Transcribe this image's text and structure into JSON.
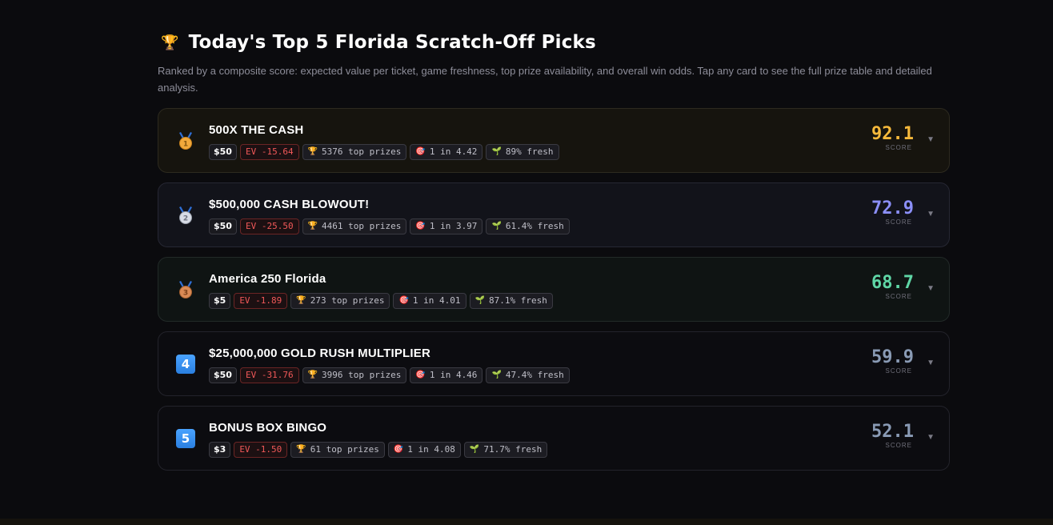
{
  "header": {
    "title": "Today's Top 5 Florida Scratch-Off Picks",
    "subtitle": "Ranked by a composite score: expected value per ticket, game freshness, top prize availability, and overall win odds. Tap any card to see the full prize table and detailed analysis."
  },
  "score_label": "SCORE",
  "games": [
    {
      "rank": "1",
      "rank_icon": "gold-medal-icon",
      "name": "500X THE CASH",
      "price": "$50",
      "ev": "EV -15.64",
      "top_prizes": "5376 top prizes",
      "odds": "1 in 4.42",
      "fresh": "89% fresh",
      "score": "92.1",
      "score_color": "#f6b93b"
    },
    {
      "rank": "2",
      "rank_icon": "silver-medal-icon",
      "name": "$500,000 CASH BLOWOUT!",
      "price": "$50",
      "ev": "EV -25.50",
      "top_prizes": "4461 top prizes",
      "odds": "1 in 3.97",
      "fresh": "61.4% fresh",
      "score": "72.9",
      "score_color": "#8b8ff8"
    },
    {
      "rank": "3",
      "rank_icon": "bronze-medal-icon",
      "name": "America 250 Florida",
      "price": "$5",
      "ev": "EV -1.89",
      "top_prizes": "273 top prizes",
      "odds": "1 in 4.01",
      "fresh": "87.1% fresh",
      "score": "68.7",
      "score_color": "#5fd6a6"
    },
    {
      "rank": "4",
      "rank_icon": "keycap-4-icon",
      "name": "$25,000,000 GOLD RUSH MULTIPLIER",
      "price": "$50",
      "ev": "EV -31.76",
      "top_prizes": "3996 top prizes",
      "odds": "1 in 4.46",
      "fresh": "47.4% fresh",
      "score": "59.9",
      "score_color": "#8a9bb5"
    },
    {
      "rank": "5",
      "rank_icon": "keycap-5-icon",
      "name": "BONUS BOX BINGO",
      "price": "$3",
      "ev": "EV -1.50",
      "top_prizes": "61 top prizes",
      "odds": "1 in 4.08",
      "fresh": "71.7% fresh",
      "score": "52.1",
      "score_color": "#8a9bb5"
    }
  ]
}
